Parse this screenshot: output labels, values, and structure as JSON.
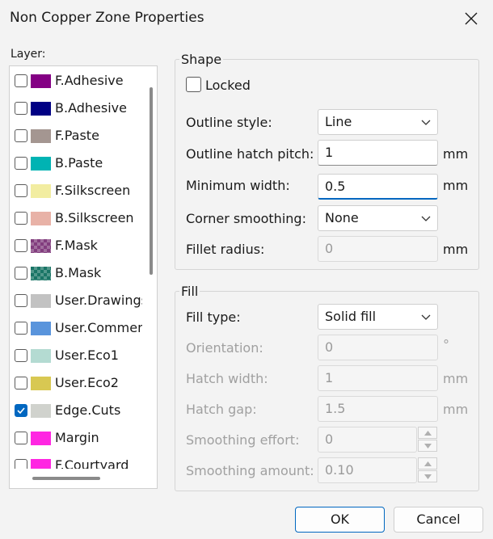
{
  "window": {
    "title": "Non Copper Zone Properties"
  },
  "layers": {
    "label": "Layer:",
    "items": [
      {
        "name": "F.Adhesive",
        "color": "#840084",
        "checked": false
      },
      {
        "name": "B.Adhesive",
        "color": "#000084",
        "checked": false
      },
      {
        "name": "F.Paste",
        "color": "#a49691",
        "checked": false
      },
      {
        "name": "B.Paste",
        "color": "#00b3b3",
        "checked": false
      },
      {
        "name": "F.Silkscreen",
        "color": "#f2eda1",
        "checked": false
      },
      {
        "name": "B.Silkscreen",
        "color": "#e8b2a7",
        "checked": false
      },
      {
        "name": "F.Mask",
        "color": "#823d7e",
        "checked": false,
        "pattern": "checker"
      },
      {
        "name": "B.Mask",
        "color": "#1a7566",
        "checked": false,
        "pattern": "checker"
      },
      {
        "name": "User.Drawings",
        "color": "#c2c2c2",
        "checked": false
      },
      {
        "name": "User.Comments",
        "color": "#5994dc",
        "checked": false
      },
      {
        "name": "User.Eco1",
        "color": "#b4dbd2",
        "checked": false
      },
      {
        "name": "User.Eco2",
        "color": "#d8c852",
        "checked": false
      },
      {
        "name": "Edge.Cuts",
        "color": "#d0d2cd",
        "checked": true
      },
      {
        "name": "Margin",
        "color": "#ff26e2",
        "checked": false
      },
      {
        "name": "F.Courtyard",
        "color": "#ff26e2",
        "checked": false
      }
    ]
  },
  "shape": {
    "title": "Shape",
    "locked_label": "Locked",
    "outline_style_label": "Outline style:",
    "outline_style_value": "Line",
    "hatch_pitch_label": "Outline hatch pitch:",
    "hatch_pitch_value": "1",
    "hatch_pitch_unit": "mm",
    "min_width_label": "Minimum width:",
    "min_width_value": "0.5",
    "min_width_unit": "mm",
    "corner_smoothing_label": "Corner smoothing:",
    "corner_smoothing_value": "None",
    "fillet_radius_label": "Fillet radius:",
    "fillet_radius_value": "0",
    "fillet_radius_unit": "mm"
  },
  "fill": {
    "title": "Fill",
    "fill_type_label": "Fill type:",
    "fill_type_value": "Solid fill",
    "orientation_label": "Orientation:",
    "orientation_value": "0",
    "orientation_unit": "°",
    "hatch_width_label": "Hatch width:",
    "hatch_width_value": "1",
    "hatch_width_unit": "mm",
    "hatch_gap_label": "Hatch gap:",
    "hatch_gap_value": "1.5",
    "hatch_gap_unit": "mm",
    "smoothing_effort_label": "Smoothing effort:",
    "smoothing_effort_value": "0",
    "smoothing_amount_label": "Smoothing amount:",
    "smoothing_amount_value": "0.10"
  },
  "buttons": {
    "ok": "OK",
    "cancel": "Cancel"
  }
}
